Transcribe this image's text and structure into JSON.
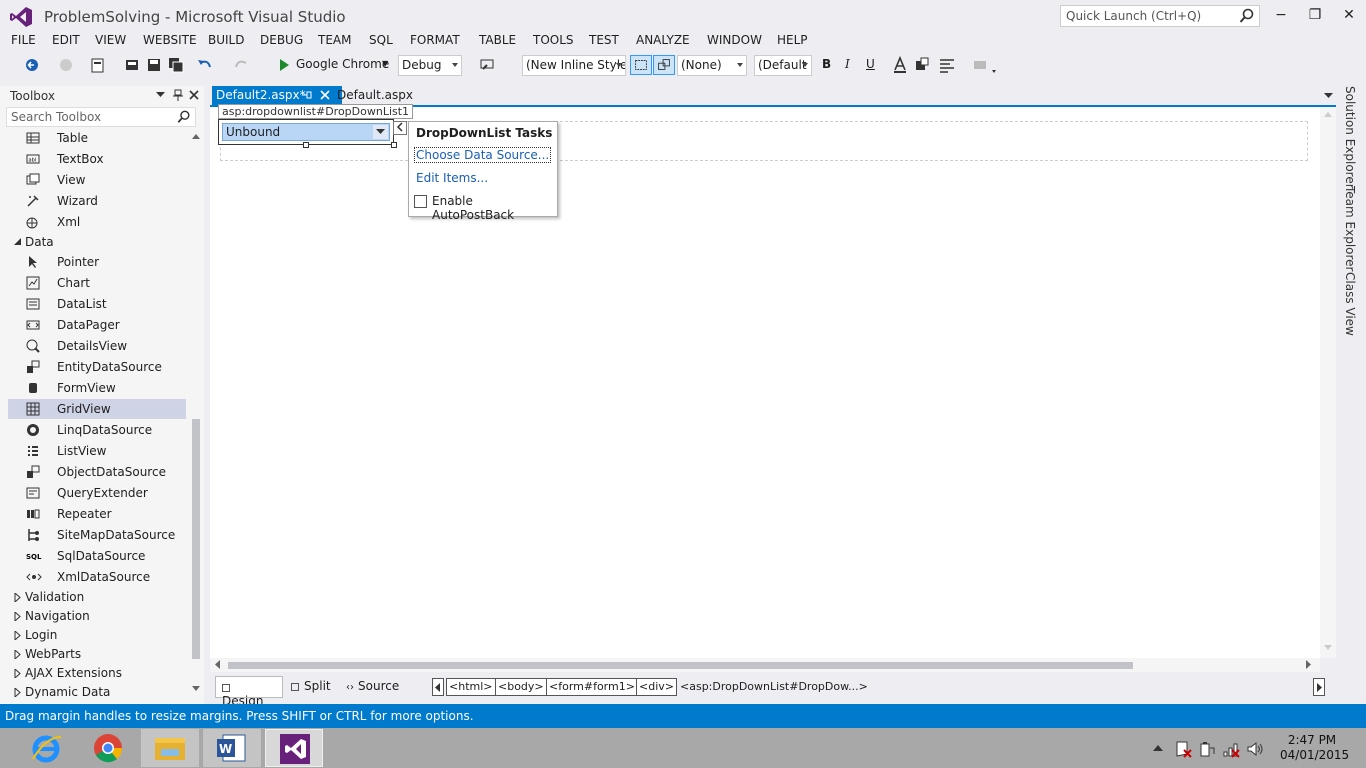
{
  "window": {
    "title": "ProblemSolving - Microsoft Visual Studio",
    "quick_launch_placeholder": "Quick Launch (Ctrl+Q)",
    "minimize": "−",
    "restore": "❐",
    "close": "✕"
  },
  "menu": [
    "FILE",
    "EDIT",
    "VIEW",
    "WEBSITE",
    "BUILD",
    "DEBUG",
    "TEAM",
    "SQL",
    "FORMAT",
    "TABLE",
    "TOOLS",
    "TEST",
    "ANALYZE",
    "WINDOW",
    "HELP"
  ],
  "toolbar": {
    "run_target": "Google Chrome",
    "configuration": "Debug",
    "style": "(New Inline Style",
    "target_rule": "(None)",
    "font": "(Default",
    "bold": "B",
    "italic": "I",
    "underline": "U"
  },
  "toolbox": {
    "title": "Toolbox",
    "search_placeholder": "Search Toolbox",
    "items_top": [
      {
        "label": "Table",
        "icon": "table-icon"
      },
      {
        "label": "TextBox",
        "icon": "textbox-icon"
      },
      {
        "label": "View",
        "icon": "view-icon"
      },
      {
        "label": "Wizard",
        "icon": "wizard-icon"
      },
      {
        "label": "Xml",
        "icon": "xml-icon"
      }
    ],
    "data_category": "Data",
    "data_items": [
      {
        "label": "Pointer",
        "icon": "pointer-icon"
      },
      {
        "label": "Chart",
        "icon": "chart-icon"
      },
      {
        "label": "DataList",
        "icon": "datalist-icon"
      },
      {
        "label": "DataPager",
        "icon": "datapager-icon"
      },
      {
        "label": "DetailsView",
        "icon": "detailsview-icon"
      },
      {
        "label": "EntityDataSource",
        "icon": "entitydatasource-icon"
      },
      {
        "label": "FormView",
        "icon": "formview-icon"
      },
      {
        "label": "GridView",
        "icon": "gridview-icon"
      },
      {
        "label": "LinqDataSource",
        "icon": "linqdatasource-icon"
      },
      {
        "label": "ListView",
        "icon": "listview-icon"
      },
      {
        "label": "ObjectDataSource",
        "icon": "objectdatasource-icon"
      },
      {
        "label": "QueryExtender",
        "icon": "queryextender-icon"
      },
      {
        "label": "Repeater",
        "icon": "repeater-icon"
      },
      {
        "label": "SiteMapDataSource",
        "icon": "sitemapdatasource-icon"
      },
      {
        "label": "SqlDataSource",
        "icon": "sqldatasource-icon"
      },
      {
        "label": "XmlDataSource",
        "icon": "xmldatasource-icon"
      }
    ],
    "selected_item": "GridView",
    "categories_bottom": [
      "Validation",
      "Navigation",
      "Login",
      "WebParts",
      "AJAX Extensions",
      "Dynamic Data"
    ]
  },
  "tabs": {
    "active": "Default2.aspx*",
    "inactive": "Default.aspx"
  },
  "designer": {
    "tag_label": "asp:dropdownlist#DropDownList1",
    "dropdown_value": "Unbound",
    "tasks": {
      "title": "DropDownList Tasks",
      "choose_data_source": "Choose Data Source...",
      "edit_items": "Edit Items...",
      "autopostback_label": "Enable AutoPostBack",
      "autopostback_checked": false
    }
  },
  "bottom": {
    "views": [
      "Design",
      "Split",
      "Source"
    ],
    "breadcrumbs": [
      "<html>",
      "<body>",
      "<form#form1>",
      "<div>"
    ],
    "current_tag": "<asp:DropDownList#DropDow...>"
  },
  "side_tabs": [
    "Solution Explorer",
    "Team Explorer",
    "Class View"
  ],
  "status": "Drag margin handles to resize margins. Press SHIFT or CTRL for more options.",
  "clock": {
    "time": "2:47 PM",
    "date": "04/01/2015"
  },
  "colors": {
    "accent": "#007acc",
    "vs_purple": "#68217a",
    "taskbar": "#a8a8a8"
  }
}
